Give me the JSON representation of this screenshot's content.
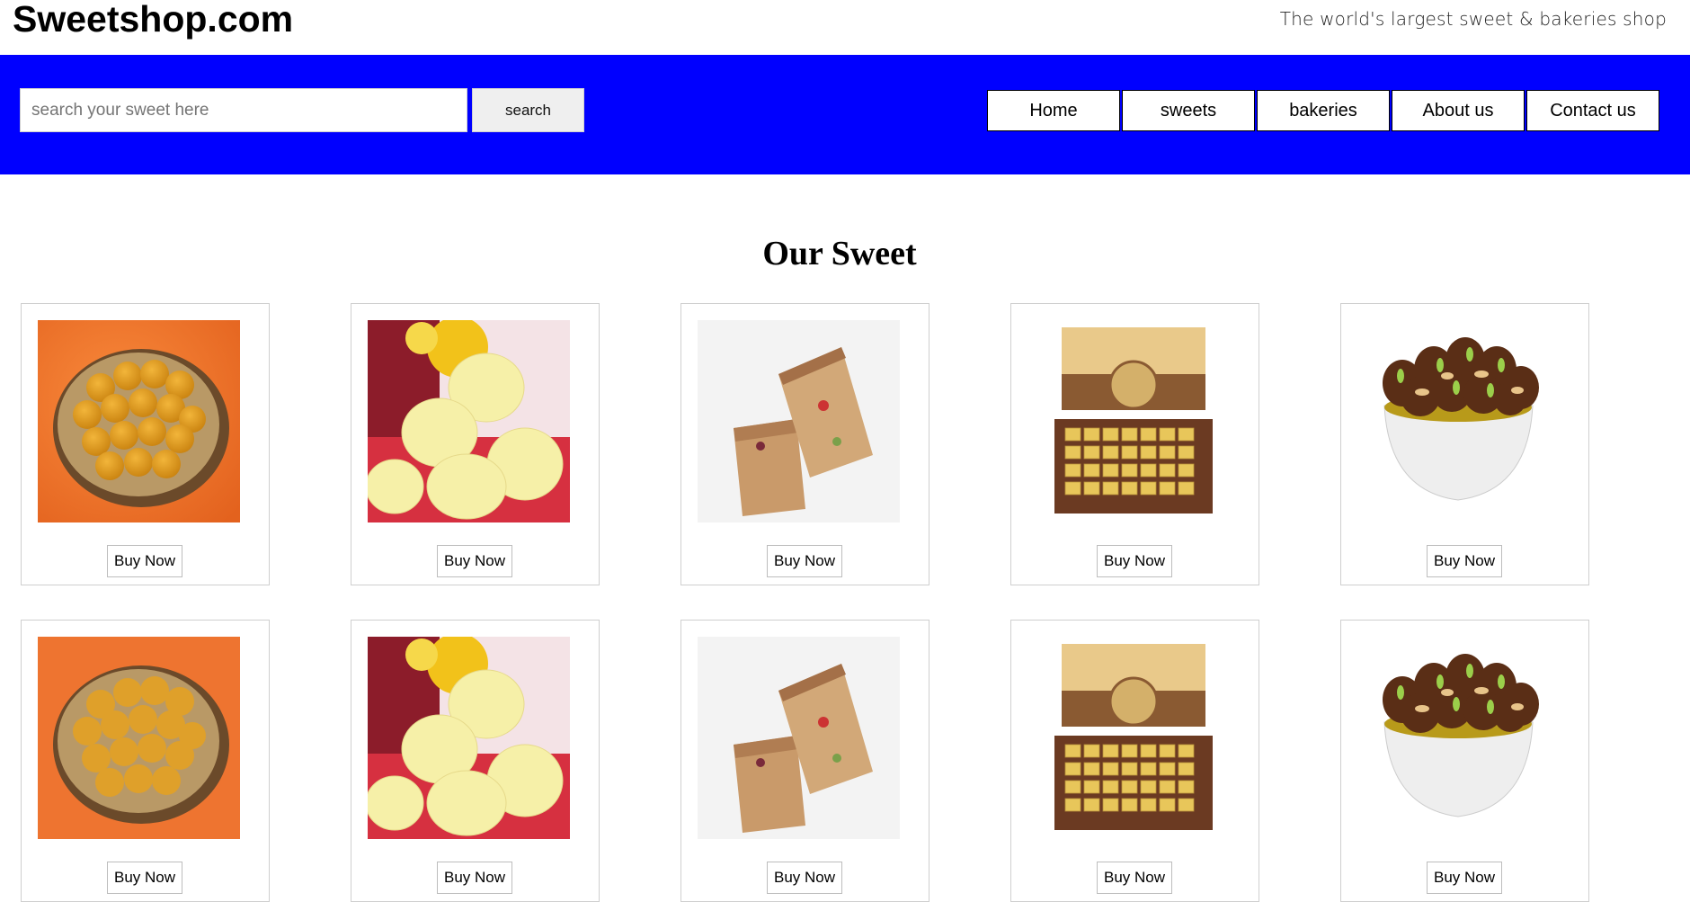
{
  "header": {
    "logo": "Sweetshop.com",
    "tagline": "The world's largest sweet & bakeries shop"
  },
  "search": {
    "placeholder": "search your sweet here",
    "value": "",
    "button_label": "search"
  },
  "nav": {
    "items": [
      {
        "label": "Home"
      },
      {
        "label": "sweets"
      },
      {
        "label": "bakeries"
      },
      {
        "label": "About us"
      },
      {
        "label": "Contact us"
      }
    ]
  },
  "colors": {
    "nav_band": "#0000ff"
  },
  "main": {
    "title": "Our Sweet",
    "products": [
      {
        "image": "laddu-photo",
        "button": "Buy Now"
      },
      {
        "image": "rasgulla-photo",
        "button": "Buy Now"
      },
      {
        "image": "milk-cake-photo",
        "button": "Buy Now"
      },
      {
        "image": "chocolate-box-photo",
        "button": "Buy Now"
      },
      {
        "image": "dry-fruit-bowl-photo",
        "button": "Buy Now"
      },
      {
        "image": "laddu-photo",
        "button": "Buy Now"
      },
      {
        "image": "rasgulla-photo",
        "button": "Buy Now"
      },
      {
        "image": "milk-cake-photo",
        "button": "Buy Now"
      },
      {
        "image": "chocolate-box-photo",
        "button": "Buy Now"
      },
      {
        "image": "dry-fruit-bowl-photo",
        "button": "Buy Now"
      }
    ]
  }
}
